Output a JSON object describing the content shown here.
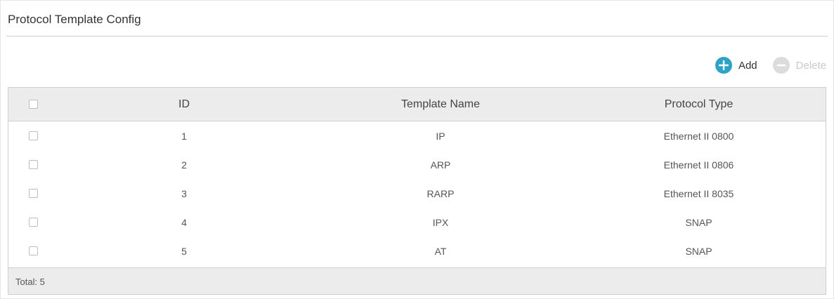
{
  "panel": {
    "title": "Protocol Template Config"
  },
  "toolbar": {
    "add_label": "Add",
    "delete_label": "Delete",
    "add_icon": "plus-circle-icon",
    "delete_icon": "minus-circle-icon",
    "add_color": "#2fa3c6",
    "delete_color": "#dcdcdc"
  },
  "table": {
    "columns": [
      "ID",
      "Template Name",
      "Protocol Type"
    ],
    "rows": [
      {
        "id": "1",
        "name": "IP",
        "type": "Ethernet II 0800"
      },
      {
        "id": "2",
        "name": "ARP",
        "type": "Ethernet II 0806"
      },
      {
        "id": "3",
        "name": "RARP",
        "type": "Ethernet II 8035"
      },
      {
        "id": "4",
        "name": "IPX",
        "type": "SNAP"
      },
      {
        "id": "5",
        "name": "AT",
        "type": "SNAP"
      }
    ],
    "footer": "Total: 5"
  }
}
